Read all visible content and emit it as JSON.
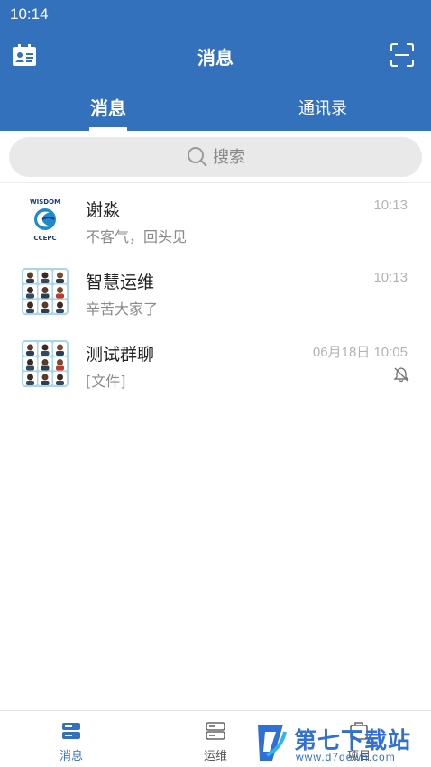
{
  "status_bar": {
    "time": "10:14"
  },
  "header": {
    "title": "消息",
    "left_icon": "contact-card-icon",
    "right_icon": "scan-icon"
  },
  "tabs": [
    {
      "label": "消息",
      "active": true
    },
    {
      "label": "通讯录",
      "active": false
    }
  ],
  "search": {
    "placeholder": "搜索",
    "icon": "search-icon"
  },
  "conversations": [
    {
      "name": "谢淼",
      "preview": "不客气，回头见",
      "time": "10:13",
      "avatar": "company-logo",
      "avatar_text_top": "WISDOM",
      "avatar_text_bottom": "CCEPC",
      "muted": false
    },
    {
      "name": "智慧运维",
      "preview": "辛苦大家了",
      "time": "10:13",
      "avatar": "group-avatar",
      "muted": false
    },
    {
      "name": "测试群聊",
      "preview": "[文件]",
      "time": "06月18日 10:05",
      "avatar": "group-avatar",
      "muted": true
    }
  ],
  "bottom_nav": [
    {
      "label": "消息",
      "icon": "message-nav-icon",
      "active": true
    },
    {
      "label": "运维",
      "icon": "server-nav-icon",
      "active": false
    },
    {
      "label": "项目",
      "icon": "project-nav-icon",
      "active": false
    }
  ],
  "watermark": {
    "title": "第七下载站",
    "url": "www.d7down.com"
  },
  "colors": {
    "primary": "#3371bd",
    "muted_text": "#8a8a8a",
    "time_text": "#b3b3b3"
  }
}
